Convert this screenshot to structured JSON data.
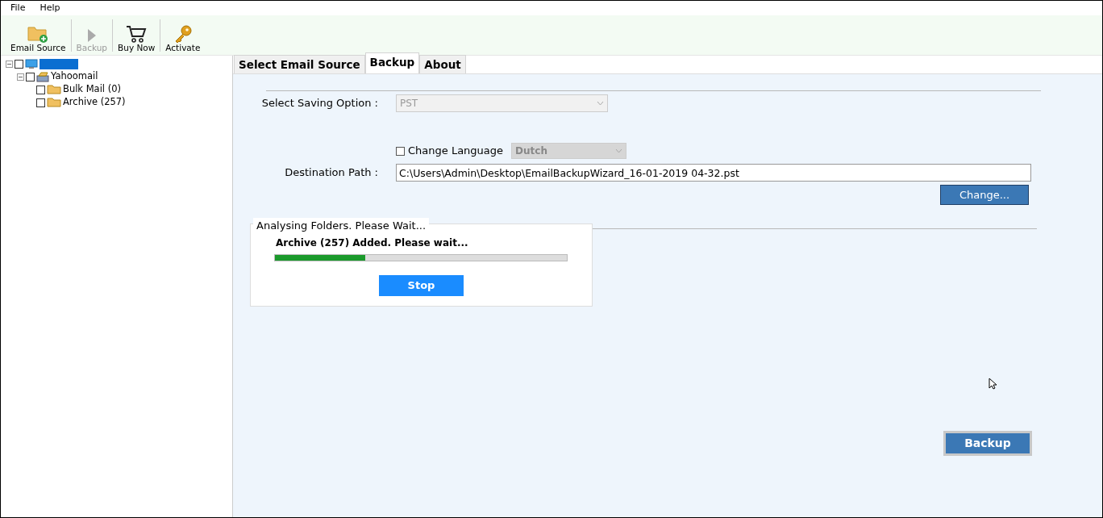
{
  "menu": [
    "File",
    "Help"
  ],
  "toolbar": [
    {
      "label": "Email Source",
      "kind": "folder",
      "disabled": false
    },
    {
      "label": "Backup",
      "kind": "play",
      "disabled": true
    },
    {
      "label": "Buy Now",
      "kind": "cart",
      "disabled": false
    },
    {
      "label": "Activate",
      "kind": "key",
      "disabled": false
    }
  ],
  "tree": {
    "selected": true,
    "checked": false,
    "expanded": true,
    "children": [
      {
        "label": "Yahoomail",
        "checked": false,
        "expanded": true,
        "children": [
          {
            "label": "Bulk Mail (0)",
            "checked": false
          },
          {
            "label": "Archive (257)",
            "checked": false
          }
        ]
      }
    ]
  },
  "tabs": [
    {
      "label": "Select Email Source",
      "selected": false
    },
    {
      "label": "Backup",
      "selected": true
    },
    {
      "label": "About",
      "selected": false
    }
  ],
  "saving_option": {
    "label": "Select Saving Option :",
    "value": "PST",
    "disabled": true
  },
  "change_language": {
    "label": "Change Language",
    "checked": false,
    "value": "Dutch",
    "disabled": true
  },
  "destination": {
    "label": "Destination Path :",
    "value": "C:\\Users\\Admin\\Desktop\\EmailBackupWizard_16-01-2019 04-32.pst"
  },
  "change_button": "Change...",
  "progress_group": {
    "title": "Analysing Folders. Please Wait...",
    "message": "Archive (257) Added. Please wait...",
    "level": 0.31,
    "stop_button": "Stop"
  },
  "backup_button": "Backup"
}
